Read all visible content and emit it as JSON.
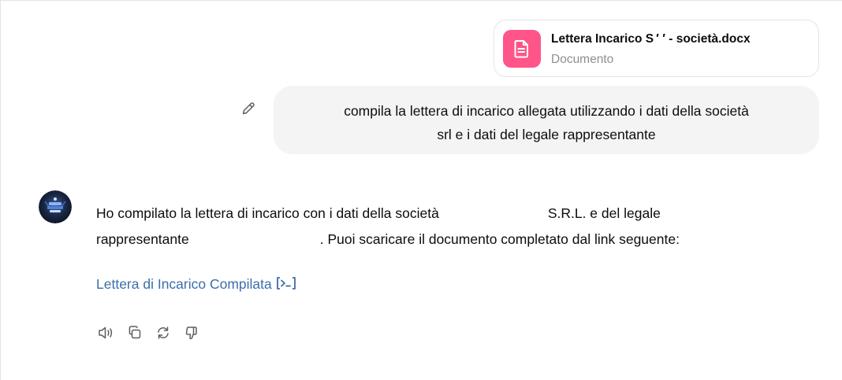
{
  "attachment": {
    "file_name": "Lettera Incarico S ′ ′ - società.docx",
    "file_type": "Documento",
    "icon": "document-icon",
    "icon_color": "#ff5588"
  },
  "user_message": {
    "line1": "compila la lettera di incarico allegata utilizzando i dati della società",
    "line2": "srl e i dati del legale rappresentante",
    "edit_icon": "pencil-icon"
  },
  "assistant_message": {
    "avatar": "assistant-avatar",
    "part1": "Ho compilato la lettera di incarico con i dati della società",
    "part2": "S.R.L. e del legale",
    "part3": "rappresentante",
    "part4": ". Puoi scaricare il documento completato dal link seguente:",
    "link_label": "Lettera di Incarico Compilata",
    "link_color": "#3b6ea8",
    "link_icon": "code-interpreter-icon"
  },
  "actions": [
    {
      "name": "read-aloud",
      "icon": "speaker-icon"
    },
    {
      "name": "copy",
      "icon": "copy-icon"
    },
    {
      "name": "regenerate",
      "icon": "refresh-icon"
    },
    {
      "name": "bad-response",
      "icon": "thumbs-down-icon"
    }
  ]
}
